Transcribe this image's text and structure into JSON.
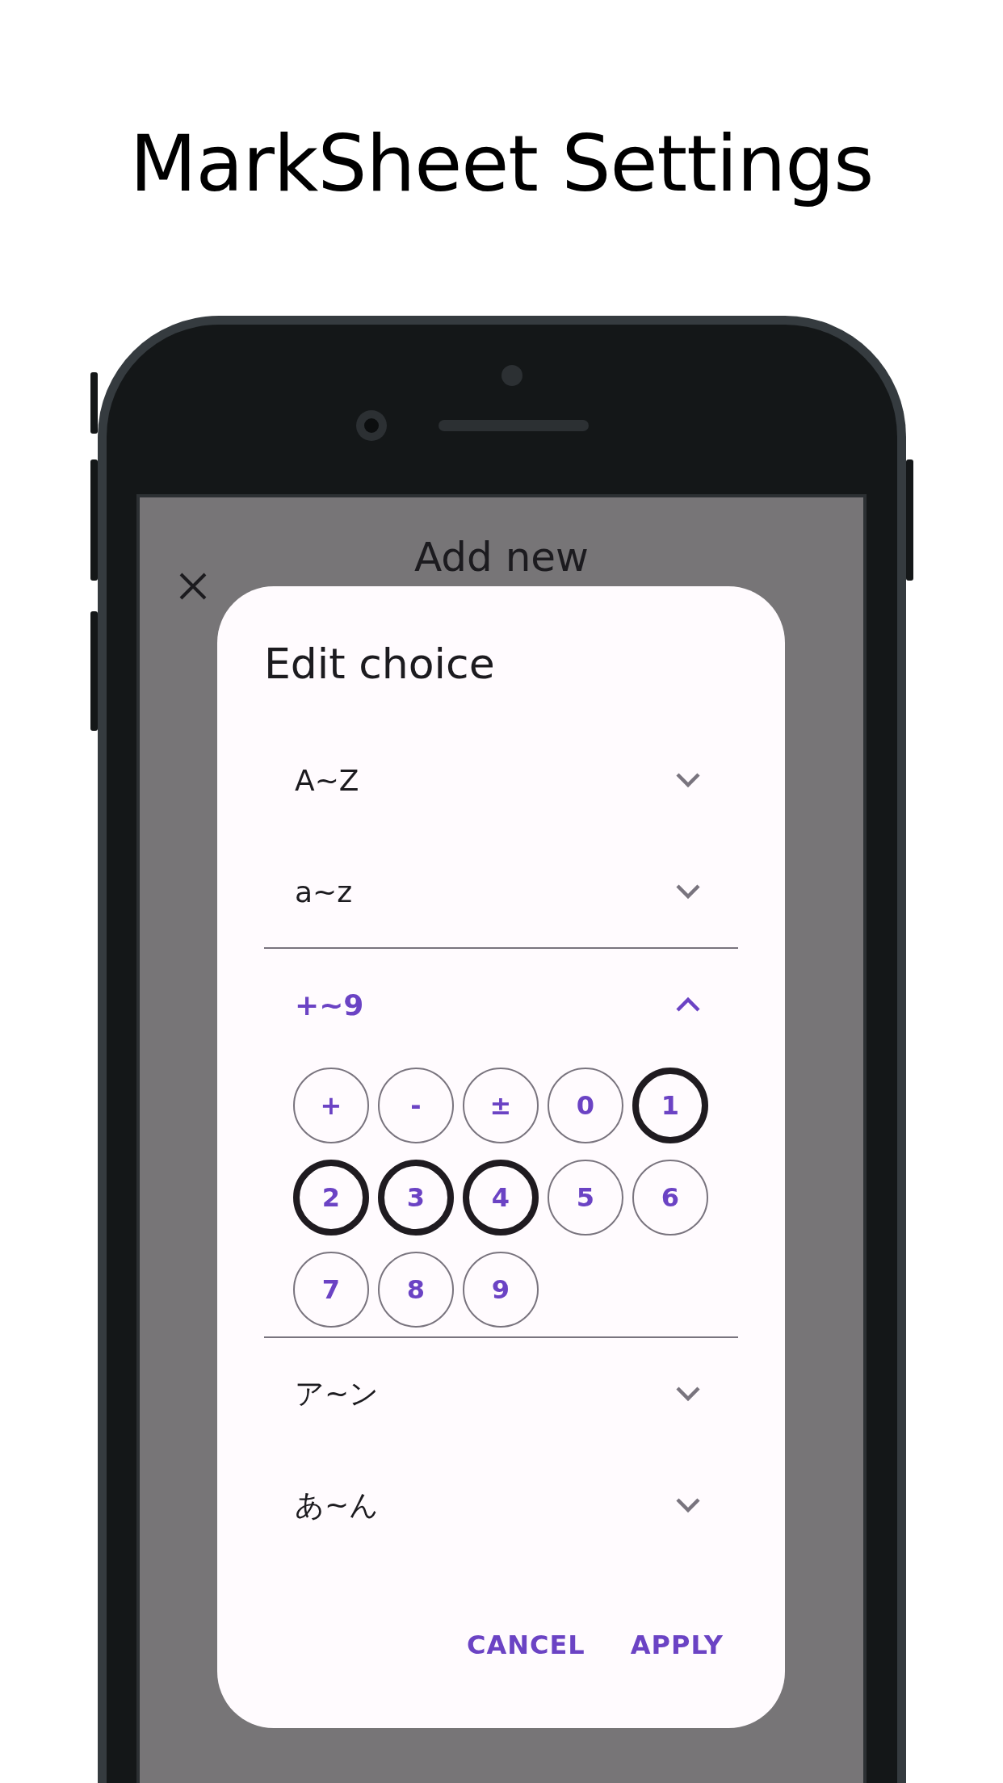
{
  "heading": "MarkSheet Settings",
  "app_bar": {
    "title": "Add new"
  },
  "dialog": {
    "title": "Edit choice",
    "groups": [
      {
        "label": "A~Z",
        "expanded": false
      },
      {
        "label": "a~z",
        "expanded": false
      },
      {
        "label": "+~9",
        "expanded": true,
        "choices": [
          {
            "label": "+",
            "selected": false
          },
          {
            "label": "-",
            "selected": false
          },
          {
            "label": "±",
            "selected": false
          },
          {
            "label": "0",
            "selected": false
          },
          {
            "label": "1",
            "selected": true
          },
          {
            "label": "2",
            "selected": true
          },
          {
            "label": "3",
            "selected": true
          },
          {
            "label": "4",
            "selected": true
          },
          {
            "label": "5",
            "selected": false
          },
          {
            "label": "6",
            "selected": false
          },
          {
            "label": "7",
            "selected": false
          },
          {
            "label": "8",
            "selected": false
          },
          {
            "label": "9",
            "selected": false
          }
        ]
      },
      {
        "label": "ア~ン",
        "expanded": false
      },
      {
        "label": "あ~ん",
        "expanded": false
      }
    ],
    "buttons": [
      "CANCEL",
      "APPLY"
    ]
  }
}
